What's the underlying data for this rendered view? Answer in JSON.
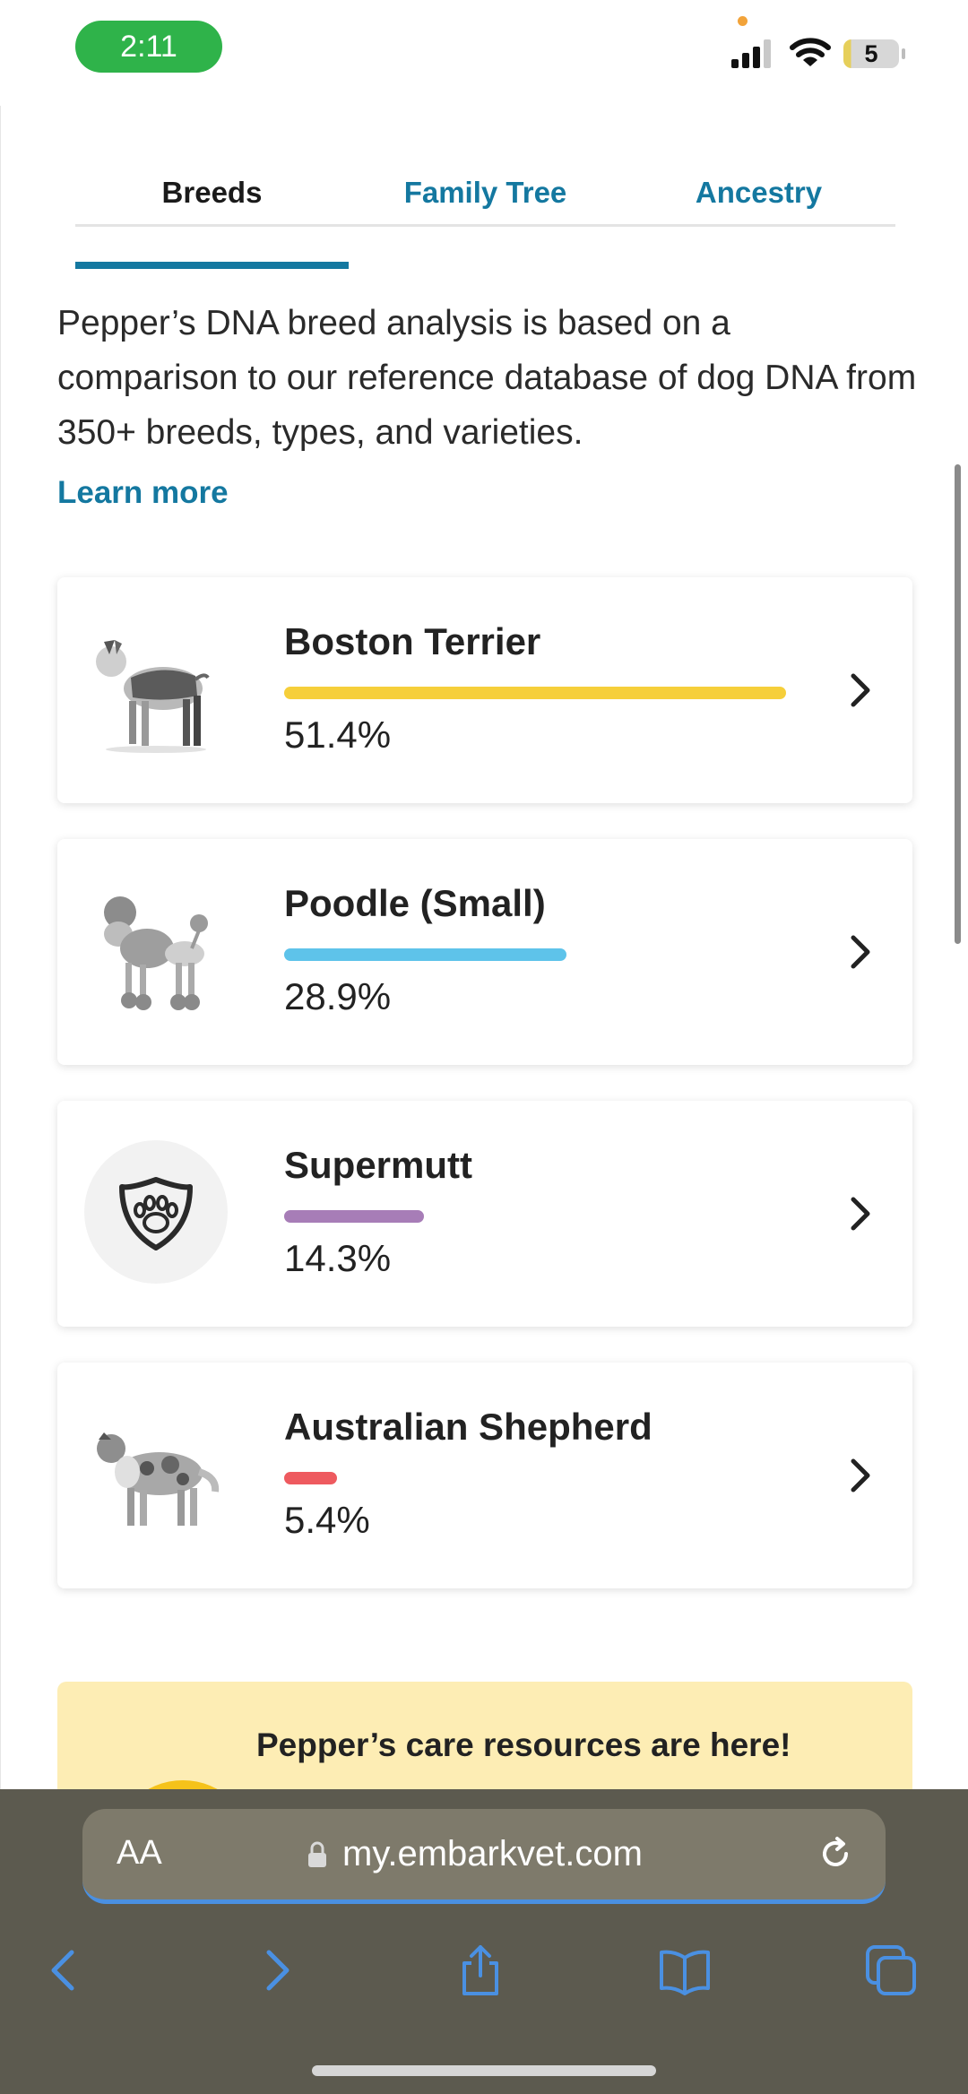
{
  "status_bar": {
    "time": "2:11",
    "battery": "5"
  },
  "tabs": [
    {
      "label": "Breeds",
      "selected": true
    },
    {
      "label": "Family Tree",
      "selected": false
    },
    {
      "label": "Ancestry",
      "selected": false
    }
  ],
  "intro": {
    "text": "Pepper’s DNA breed analysis is based on a comparison to our reference database of dog DNA from 350+ breeds, types, and varieties.",
    "learn_more": "Learn more"
  },
  "breeds": [
    {
      "name": "Boston Terrier",
      "percent": "51.4%",
      "fraction": 0.514,
      "color": "#f6cf3a",
      "icon": "boston-terrier-illustration"
    },
    {
      "name": "Poodle (Small)",
      "percent": "28.9%",
      "fraction": 0.289,
      "color": "#5ec3ea",
      "icon": "poodle-illustration"
    },
    {
      "name": "Supermutt",
      "percent": "14.3%",
      "fraction": 0.143,
      "color": "#a77db7",
      "icon": "paw-shield-icon"
    },
    {
      "name": "Australian Shepherd",
      "percent": "5.4%",
      "fraction": 0.054,
      "color": "#ee5a5f",
      "icon": "australian-shepherd-illustration"
    }
  ],
  "promo": {
    "title": "Pepper’s care resources are here!"
  },
  "browser": {
    "text_size_label": "AA",
    "url": "my.embarkvet.com"
  },
  "colors": {
    "accent": "#1478a0",
    "safari_bar": "#5c5a4f",
    "safari_icon": "#4a90e2"
  }
}
